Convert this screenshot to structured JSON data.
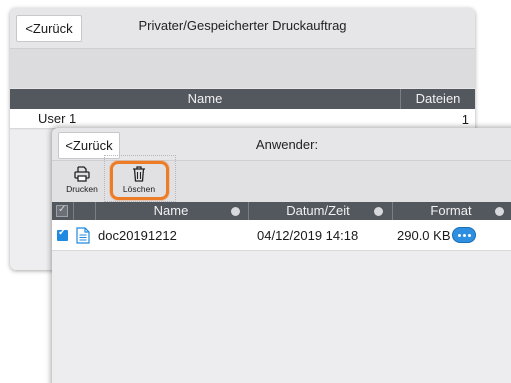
{
  "back_window": {
    "back_label": "<Zurück",
    "title": "Privater/Gespeicherter Druckauftrag",
    "columns": {
      "name": "Name",
      "files": "Dateien"
    },
    "rows": [
      {
        "name": "User 1",
        "files": "1"
      }
    ]
  },
  "front_window": {
    "back_label": "<Zurück",
    "title": "Anwender:",
    "toolbar": {
      "print_label": "Drucken",
      "delete_label": "Löschen"
    },
    "columns": {
      "name": "Name",
      "date": "Datum/Zeit",
      "format": "Format"
    },
    "rows": [
      {
        "checked": true,
        "name": "doc20191212",
        "date": "04/12/2019 14:18",
        "size": "290.0 KB"
      }
    ]
  },
  "colors": {
    "header_bg": "#53575e",
    "accent_orange": "#ec7c25",
    "accent_blue": "#1f8ae0"
  },
  "icons": [
    "printer-icon",
    "trash-icon",
    "document-icon",
    "more-options-icon",
    "checkbox-icon",
    "sort-icon"
  ]
}
